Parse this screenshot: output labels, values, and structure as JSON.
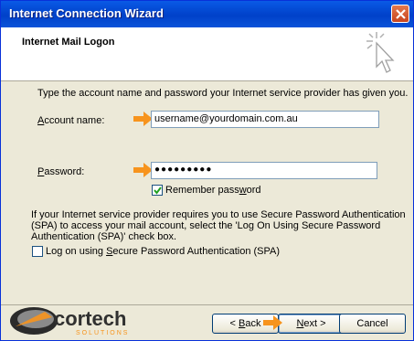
{
  "window": {
    "title": "Internet Connection Wizard"
  },
  "header": {
    "title": "Internet Mail Logon"
  },
  "intro": "Type the account name and password your Internet service provider has given you.",
  "account": {
    "label_pre": "",
    "label_hot": "A",
    "label_post": "ccount name:",
    "value": "username@yourdomain.com.au"
  },
  "password": {
    "label_pre": "",
    "label_hot": "P",
    "label_post": "assword:",
    "value": "●●●●●●●●●"
  },
  "remember": {
    "label_pre": "Remember pass",
    "label_hot": "w",
    "label_post": "ord",
    "checked": true
  },
  "spa_note": {
    "line1": "If your Internet service provider requires you to use Secure Password Authentication",
    "line2": "(SPA) to access your mail account, select the 'Log On Using Secure Password",
    "line3": "Authentication (SPA)' check box."
  },
  "spa": {
    "label_pre": "Log on using ",
    "label_hot": "S",
    "label_post": "ecure Password Authentication (SPA)",
    "checked": false
  },
  "logo": {
    "name": "cortech",
    "tagline": "SOLUTIONS"
  },
  "buttons": {
    "back_pre": "< ",
    "back_hot": "B",
    "back_post": "ack",
    "next_pre": "",
    "next_hot": "N",
    "next_post": "ext >",
    "cancel": "Cancel"
  },
  "colors": {
    "arrow": "#f7941d",
    "titlebar": "#0a53d9"
  }
}
